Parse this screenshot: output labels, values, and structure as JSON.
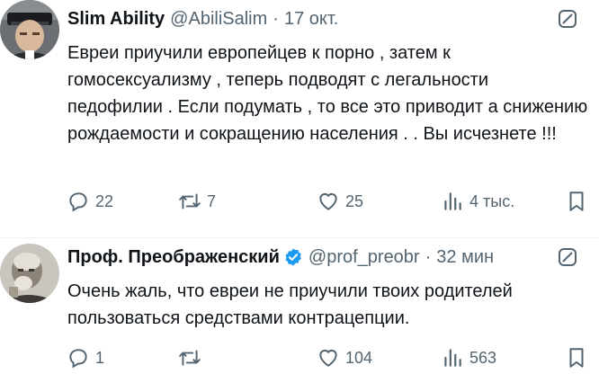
{
  "tweets": [
    {
      "author": "Slim Ability",
      "handle": "@AbiliSalim",
      "separator": "·",
      "time": "17 окт.",
      "verified": false,
      "text": "Евреи приучили европейцев к порно , затем к гомосексуализму , теперь подводят с легальности педофилии . Если подумать , то все это приводит а снижению рождаемости и сокращению населения . . Вы исчезнете !!!",
      "replies": "22",
      "retweets": "7",
      "likes": "25",
      "views": "4 тыс."
    },
    {
      "author": "Проф. Преображенский",
      "handle": "@prof_preobr",
      "separator": "·",
      "time": "32 мин",
      "verified": true,
      "text": "Очень жаль, что евреи не приучили твоих родителей пользоваться средствами контрацепции.",
      "replies": "1",
      "retweets": "",
      "likes": "104",
      "views": "563"
    }
  ],
  "icons": {
    "reply": "reply-icon",
    "retweet": "retweet-icon",
    "like": "heart-icon",
    "views": "views-icon",
    "bookmark": "bookmark-icon",
    "grok": "grok-icon",
    "verified": "verified-badge-icon"
  },
  "colors": {
    "text": "#0f1419",
    "secondary": "#536471",
    "verified": "#1d9bf0",
    "divider": "#eff3f4"
  }
}
